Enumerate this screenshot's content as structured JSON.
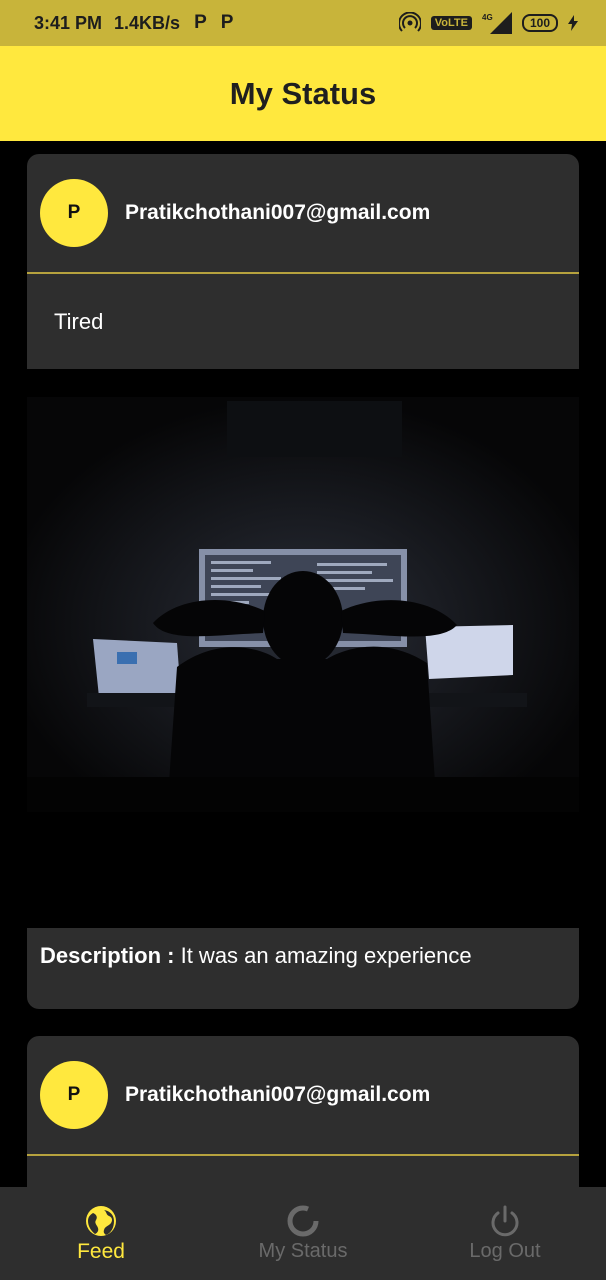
{
  "status_bar": {
    "time": "3:41 PM",
    "speed": "1.4KB/s",
    "network": "4G",
    "volte": "VoLTE",
    "battery": "100"
  },
  "app_bar": {
    "title": "My Status"
  },
  "posts": [
    {
      "avatar_letter": "P",
      "email": "Pratikchothani007@gmail.com",
      "status": "Tired",
      "image_icon": "person-at-computer-photo",
      "description_label": "Description :",
      "description": "It was an amazing experience"
    },
    {
      "avatar_letter": "P",
      "email": "Pratikchothani007@gmail.com"
    }
  ],
  "bottom_nav": {
    "items": [
      {
        "label": "Feed",
        "icon": "globe-icon",
        "active": true
      },
      {
        "label": "My Status",
        "icon": "loading-circle-icon",
        "active": false
      },
      {
        "label": "Log Out",
        "icon": "power-icon",
        "active": false
      }
    ]
  },
  "colors": {
    "accent": "#ffe83e",
    "status_bar": "#c8b43a",
    "card": "#2e2e2e",
    "background": "#000000"
  }
}
